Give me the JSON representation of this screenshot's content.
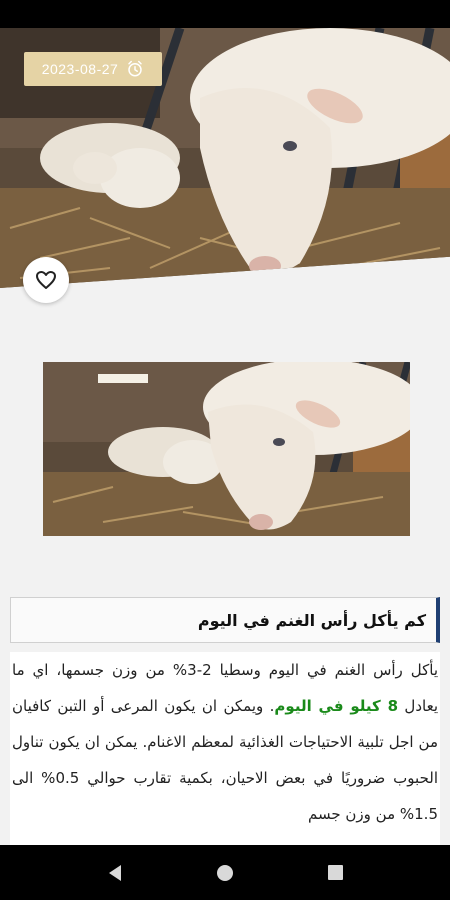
{
  "post": {
    "date": "2023-08-27",
    "heading": "كم يأكل رأس الغنم في اليوم",
    "body": {
      "part1": "يأكل رأس الغنم في اليوم وسطيا 2-3% من وزن جسمها، اي ما يعادل ",
      "highlight": "8 كيلو في اليوم",
      "part2": ". ويمكن ان يكون المرعى أو التبن كافيان من اجل تلبية الاحتياجات الغذائية لمعظم الاغنام. يمكن ان يكون تناول الحبوب ضروريًا في بعض الاحيان، بكمية تقارب حوالي 0.5% الى 1.5% من وزن جسم"
    }
  },
  "icons": {
    "date": "clock-icon",
    "favorite": "heart-icon",
    "nav_back": "triangle-back-icon",
    "nav_home": "circle-home-icon",
    "nav_recents": "square-recents-icon"
  },
  "colors": {
    "date_badge": "#e5d3a5",
    "heading_accent": "#1f3f73",
    "highlight": "#1a8a1a"
  }
}
